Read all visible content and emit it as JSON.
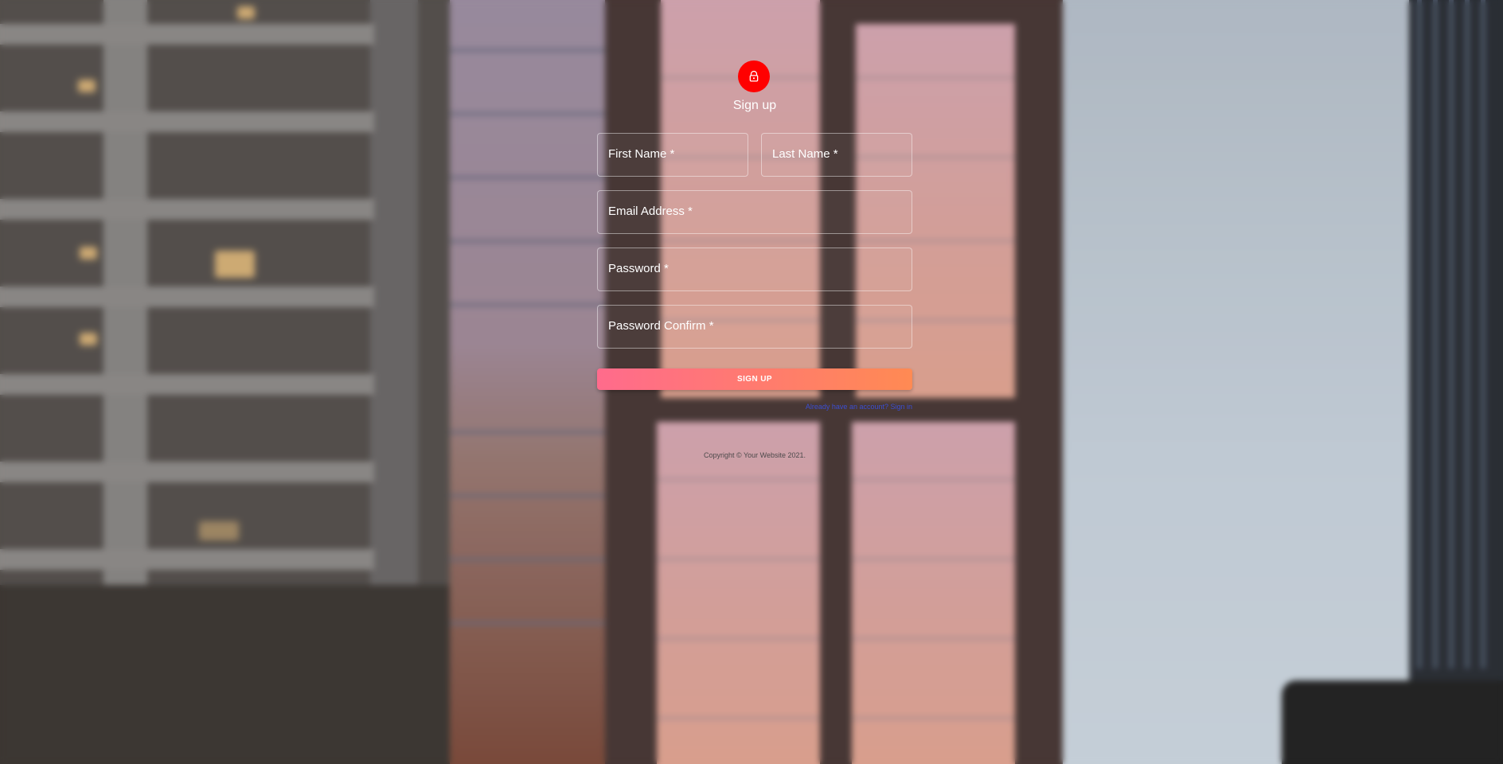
{
  "form": {
    "title": "Sign up",
    "fields": {
      "first_name": "First Name *",
      "last_name": "Last Name *",
      "email": "Email Address *",
      "password": "Password *",
      "password_confirm": "Password Confirm *"
    },
    "submit_label": "SIGN UP",
    "signin_link": "Already have an account? Sign in",
    "copyright": "Copyright © Your Website 2021."
  },
  "colors": {
    "avatar": "#ff0000",
    "button_gradient_start": "#ff6b8c",
    "button_gradient_end": "#ff8a53",
    "link": "#3b4ed0"
  },
  "icons": {
    "avatar_icon": "lock-outline-icon"
  }
}
